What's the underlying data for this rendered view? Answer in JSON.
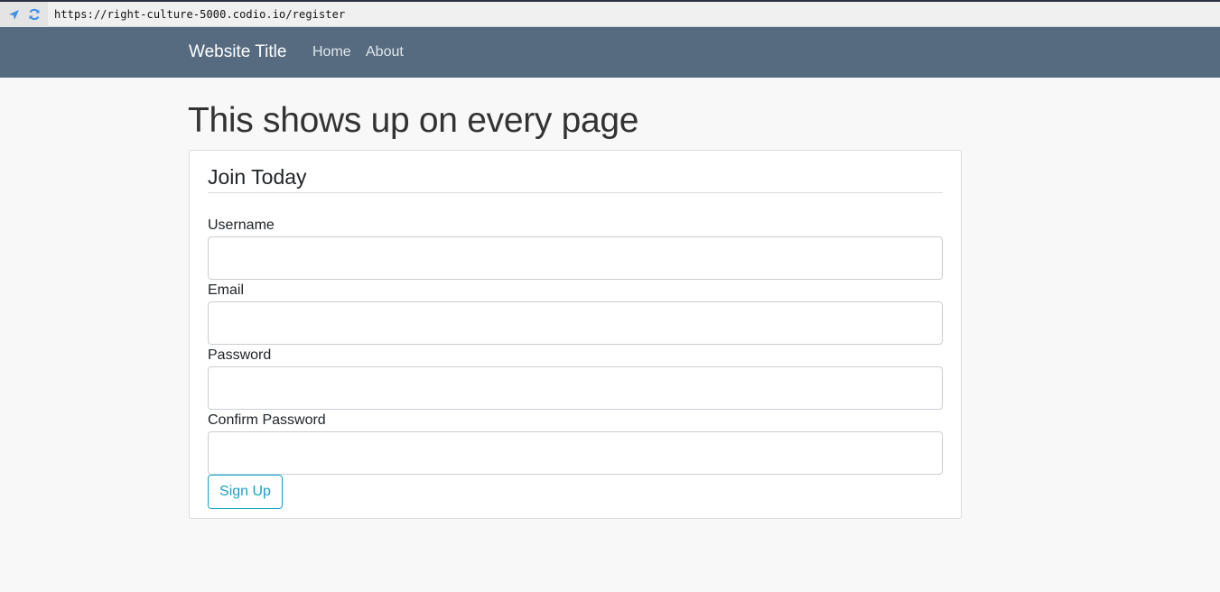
{
  "browser": {
    "url": "https://right-culture-5000.codio.io/register",
    "icons": [
      "location-arrow-icon",
      "refresh-icon"
    ],
    "icon_color": "#3b8ee6"
  },
  "navbar": {
    "brand": "Website Title",
    "links": [
      {
        "label": "Home"
      },
      {
        "label": "About"
      }
    ],
    "background": "#566b80"
  },
  "main": {
    "heading": "This shows up on every page"
  },
  "form": {
    "legend": "Join Today",
    "fields": [
      {
        "label": "Username",
        "value": "",
        "type": "text"
      },
      {
        "label": "Email",
        "value": "",
        "type": "email"
      },
      {
        "label": "Password",
        "value": "",
        "type": "password"
      },
      {
        "label": "Confirm Password",
        "value": "",
        "type": "password"
      }
    ],
    "submit_label": "Sign Up",
    "accent_color": "#17a2c8"
  }
}
